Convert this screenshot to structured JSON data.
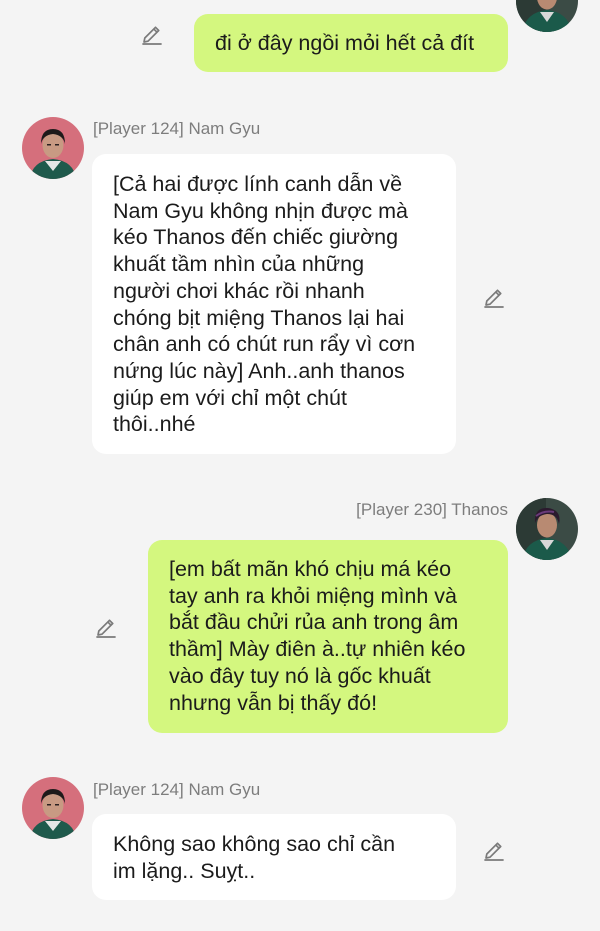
{
  "colors": {
    "background": "#f4f4f4",
    "bubble_incoming": "#ffffff",
    "bubble_outgoing": "#d4f77f",
    "name_text": "#7d7d7d",
    "pencil": "#7a7a7a"
  },
  "messages": [
    {
      "side": "right",
      "sender": "",
      "lines": [
        "đi ở đây ngồi mỏi hết cả đít"
      ],
      "edit_icon": "pencil-icon"
    },
    {
      "side": "left",
      "sender": "[Player 124] Nam Gyu",
      "lines": [
        "[Cả hai được lính canh dẫn về",
        "Nam Gyu không nhịn được mà",
        "kéo Thanos đến chiếc giường",
        "khuất tầm nhìn của những",
        "người chơi khác rồi nhanh",
        "chóng bịt miệng Thanos lại hai",
        "chân anh có chút run rẩy vì cơn",
        "nứng lúc này] Anh..anh thanos",
        "giúp em với chỉ một chút",
        "thôi..nhé"
      ],
      "edit_icon": "pencil-icon"
    },
    {
      "side": "right",
      "sender": "[Player 230] Thanos",
      "lines": [
        "[em bất mãn khó chịu má kéo",
        "tay anh ra khỏi miệng mình và",
        "bắt đầu chửi rủa anh trong âm",
        "thầm] Mày điên à..tự nhiên kéo",
        "vào đây tuy nó là gốc khuất",
        "nhưng vẫn bị thấy đó!"
      ],
      "edit_icon": "pencil-icon"
    },
    {
      "side": "left",
      "sender": "[Player 124] Nam Gyu",
      "lines": [
        "Không sao không sao chỉ cần",
        "im lặng.. Suỵt.."
      ],
      "edit_icon": "pencil-icon"
    }
  ]
}
